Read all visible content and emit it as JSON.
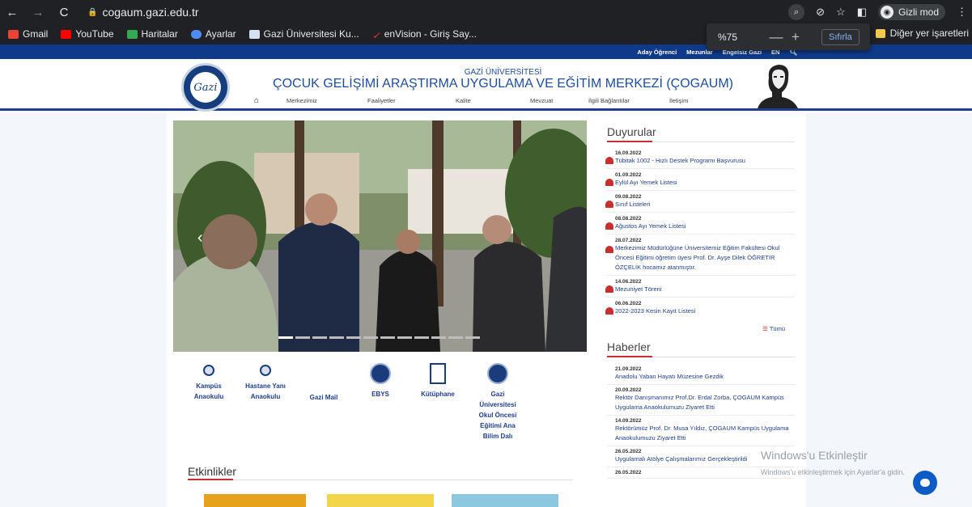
{
  "browser": {
    "url": "cogaum.gazi.edu.tr",
    "incognito_label": "Gizli mod",
    "bookmarks": [
      {
        "label": "Gmail",
        "color": "#ea4335"
      },
      {
        "label": "YouTube",
        "color": "#ff0000"
      },
      {
        "label": "Haritalar",
        "color": "#34a853"
      },
      {
        "label": "Ayarlar",
        "color": "#4f8bf0"
      },
      {
        "label": "Gazi Üniversitesi Ku...",
        "color": "#1e3f8e"
      },
      {
        "label": "enVision - Giriş Say...",
        "color": "#e53935"
      }
    ],
    "other_bookmarks": "Diğer yer işaretleri",
    "zoom": {
      "level": "%75",
      "reset": "Sıfırla",
      "minus": "—",
      "plus": "+"
    }
  },
  "site": {
    "topbar": [
      "Aday Öğrenci",
      "Mezunlar",
      "Engelsiz Gazi",
      "EN"
    ],
    "university": "GAZİ ÜNİVERSİTESİ",
    "title": "ÇOCUK GELİŞİMİ ARAŞTIRMA UYGULAMA VE EĞİTİM MERKEZİ (ÇOGAUM)",
    "logo_text": "Gazi",
    "menu": [
      "Merkezimiz",
      "Faaliyetler",
      "Kalite",
      "Mevzuat",
      "İlgili Bağlantılar",
      "İletişim"
    ]
  },
  "quick_links": [
    {
      "label": "Kampüs Anaokulu",
      "icon": "pin"
    },
    {
      "label": "Hastane Yanı Anaokulu",
      "icon": "pin"
    },
    {
      "label": "Gazi Mail",
      "icon": "none"
    },
    {
      "label": "EBYS",
      "icon": "circle"
    },
    {
      "label": "Kütüphane",
      "icon": "book"
    },
    {
      "label": "Gazi Üniversitesi Okul Öncesi Eğitimi Ana Bilim Dalı",
      "icon": "circle"
    }
  ],
  "events_title": "Etkinlikler",
  "announcements": {
    "title": "Duyurular",
    "items": [
      {
        "date": "16.09.2022",
        "text": "Tübitak 1002 - Hızlı Destek Programı Başvurusu"
      },
      {
        "date": "01.09.2022",
        "text": "Eylül Ayı Yemek Listesi"
      },
      {
        "date": "09.08.2022",
        "text": "Sınıf Listeleri"
      },
      {
        "date": "08.08.2022",
        "text": "Ağustos Ayı Yemek Listesi"
      },
      {
        "date": "28.07.2022",
        "text": "Merkezimiz Müdürlüğüne Üniversitemiz Eğitim Fakültesi Okul Öncesi Eğitimi öğretim üyesi Prof. Dr. Ayşe Dilek ÖĞRETİR ÖZÇELİK hocamız atanmıştır."
      },
      {
        "date": "14.06.2022",
        "text": "Mezuniyet Töreni"
      },
      {
        "date": "06.06.2022",
        "text": "2022-2023 Kesin Kayıt Listesi"
      }
    ],
    "all": "Tümü"
  },
  "news": {
    "title": "Haberler",
    "items": [
      {
        "date": "21.09.2022",
        "text": "Anadolu Yaban Hayatı Müzesine Gezdik"
      },
      {
        "date": "20.09.2022",
        "text": "Rektör Danışmanımız Prof.Dr. Erdal Zorba, ÇOGAUM Kampüs Uygulama Anaokulumuzu Ziyaret Etti"
      },
      {
        "date": "14.09.2022",
        "text": "Rektörümüz Prof. Dr. Musa Yıldız, ÇOGAUM Kampüs Uygulama Anaokulumuzu Ziyaret Etti"
      },
      {
        "date": "26.05.2022",
        "text": "Uygulamalı Atölye Çalışmalarımız Gerçekleştirildi"
      },
      {
        "date": "26.05.2022",
        "text": ""
      }
    ]
  },
  "windows": {
    "line1": "Windows'u Etkinleştir",
    "line2": "Windows'u etkinleştirmek için Ayarlar'a gidin."
  }
}
